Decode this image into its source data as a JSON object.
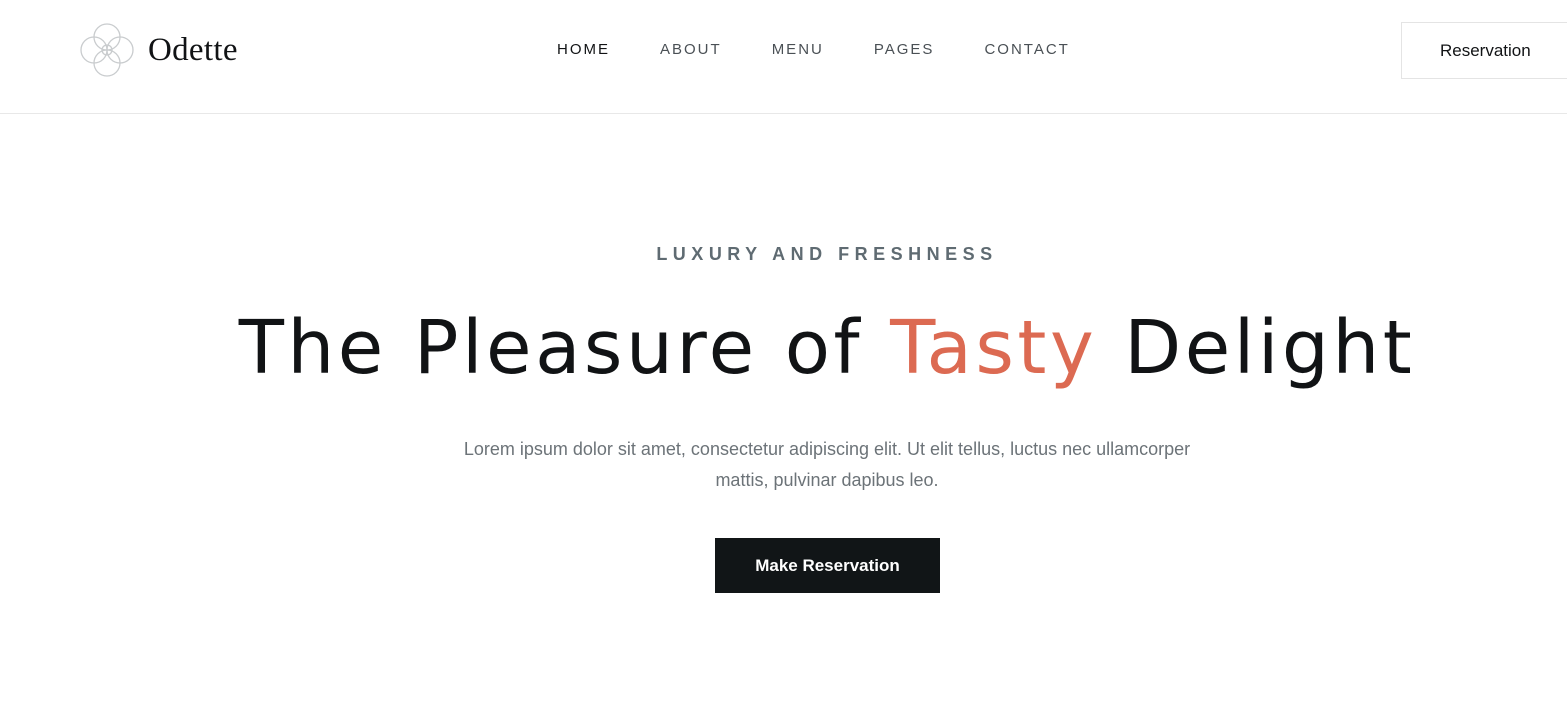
{
  "brand": {
    "name": "Odette",
    "logo_icon": "quatrefoil-rings-icon"
  },
  "nav": {
    "items": [
      {
        "label": "HOME",
        "active": true
      },
      {
        "label": "ABOUT",
        "active": false
      },
      {
        "label": "MENU",
        "active": false
      },
      {
        "label": "PAGES",
        "active": false
      },
      {
        "label": "CONTACT",
        "active": false
      }
    ]
  },
  "header": {
    "reservation_label": "Reservation"
  },
  "hero": {
    "kicker": "LUXURY AND FRESHNESS",
    "headline_before": "The Pleasure of ",
    "headline_accent": "Tasty",
    "headline_after": " Delight",
    "description": "Lorem ipsum dolor sit amet, consectetur adipiscing elit. Ut elit tellus, luctus nec ullamcorper mattis, pulvinar dapibus leo.",
    "cta_label": "Make Reservation"
  },
  "colors": {
    "accent": "#dc6a52",
    "dark": "#111315",
    "muted": "#6c7378"
  }
}
